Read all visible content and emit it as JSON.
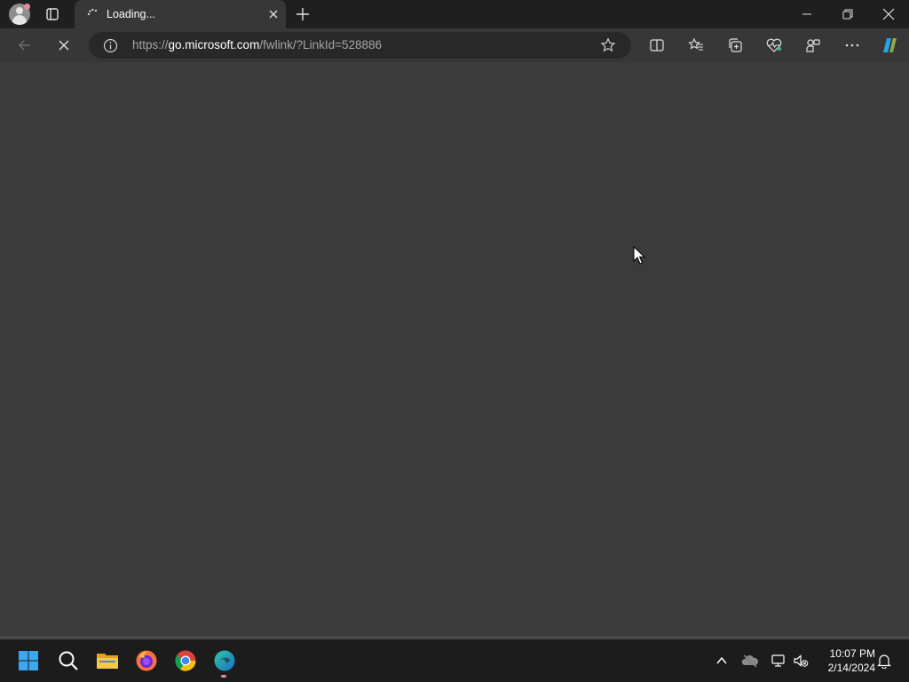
{
  "browser": {
    "tab": {
      "title": "Loading...",
      "spinner_icon": "loading-spinner-icon",
      "close_icon": "close-icon"
    },
    "new_tab_icon": "plus-icon",
    "window_controls": [
      "minimize-icon",
      "restore-icon",
      "close-icon"
    ],
    "nav": {
      "back_icon": "back-arrow-icon",
      "stop_icon": "stop-icon"
    },
    "address": {
      "url_prefix": "https://",
      "url_host": "go.microsoft.com",
      "url_path": "/fwlink/?LinkId=528886",
      "info_icon": "info-icon",
      "favorite_icon": "star-icon"
    },
    "toolbar_icons": [
      "split-screen-icon",
      "favorites-icon",
      "collections-icon",
      "browser-essentials-icon",
      "extensions-icon",
      "more-icon",
      "copilot-icon"
    ]
  },
  "taskbar": {
    "apps": [
      "windows-start-icon",
      "search-icon",
      "file-explorer-icon",
      "firefox-icon",
      "chrome-icon",
      "edge-icon"
    ],
    "tray": [
      "chevron-up-icon",
      "onedrive-offline-icon",
      "network-icon",
      "volume-muted-icon",
      "notification-bell-icon"
    ],
    "time": "10:07 PM",
    "date": "2/14/2024"
  },
  "colors": {
    "titlebar": "#1f1f1f",
    "toolbar": "#373737",
    "page": "#3b3b3b",
    "taskbar": "#1c1c1c",
    "badge": "#e48b9e"
  }
}
